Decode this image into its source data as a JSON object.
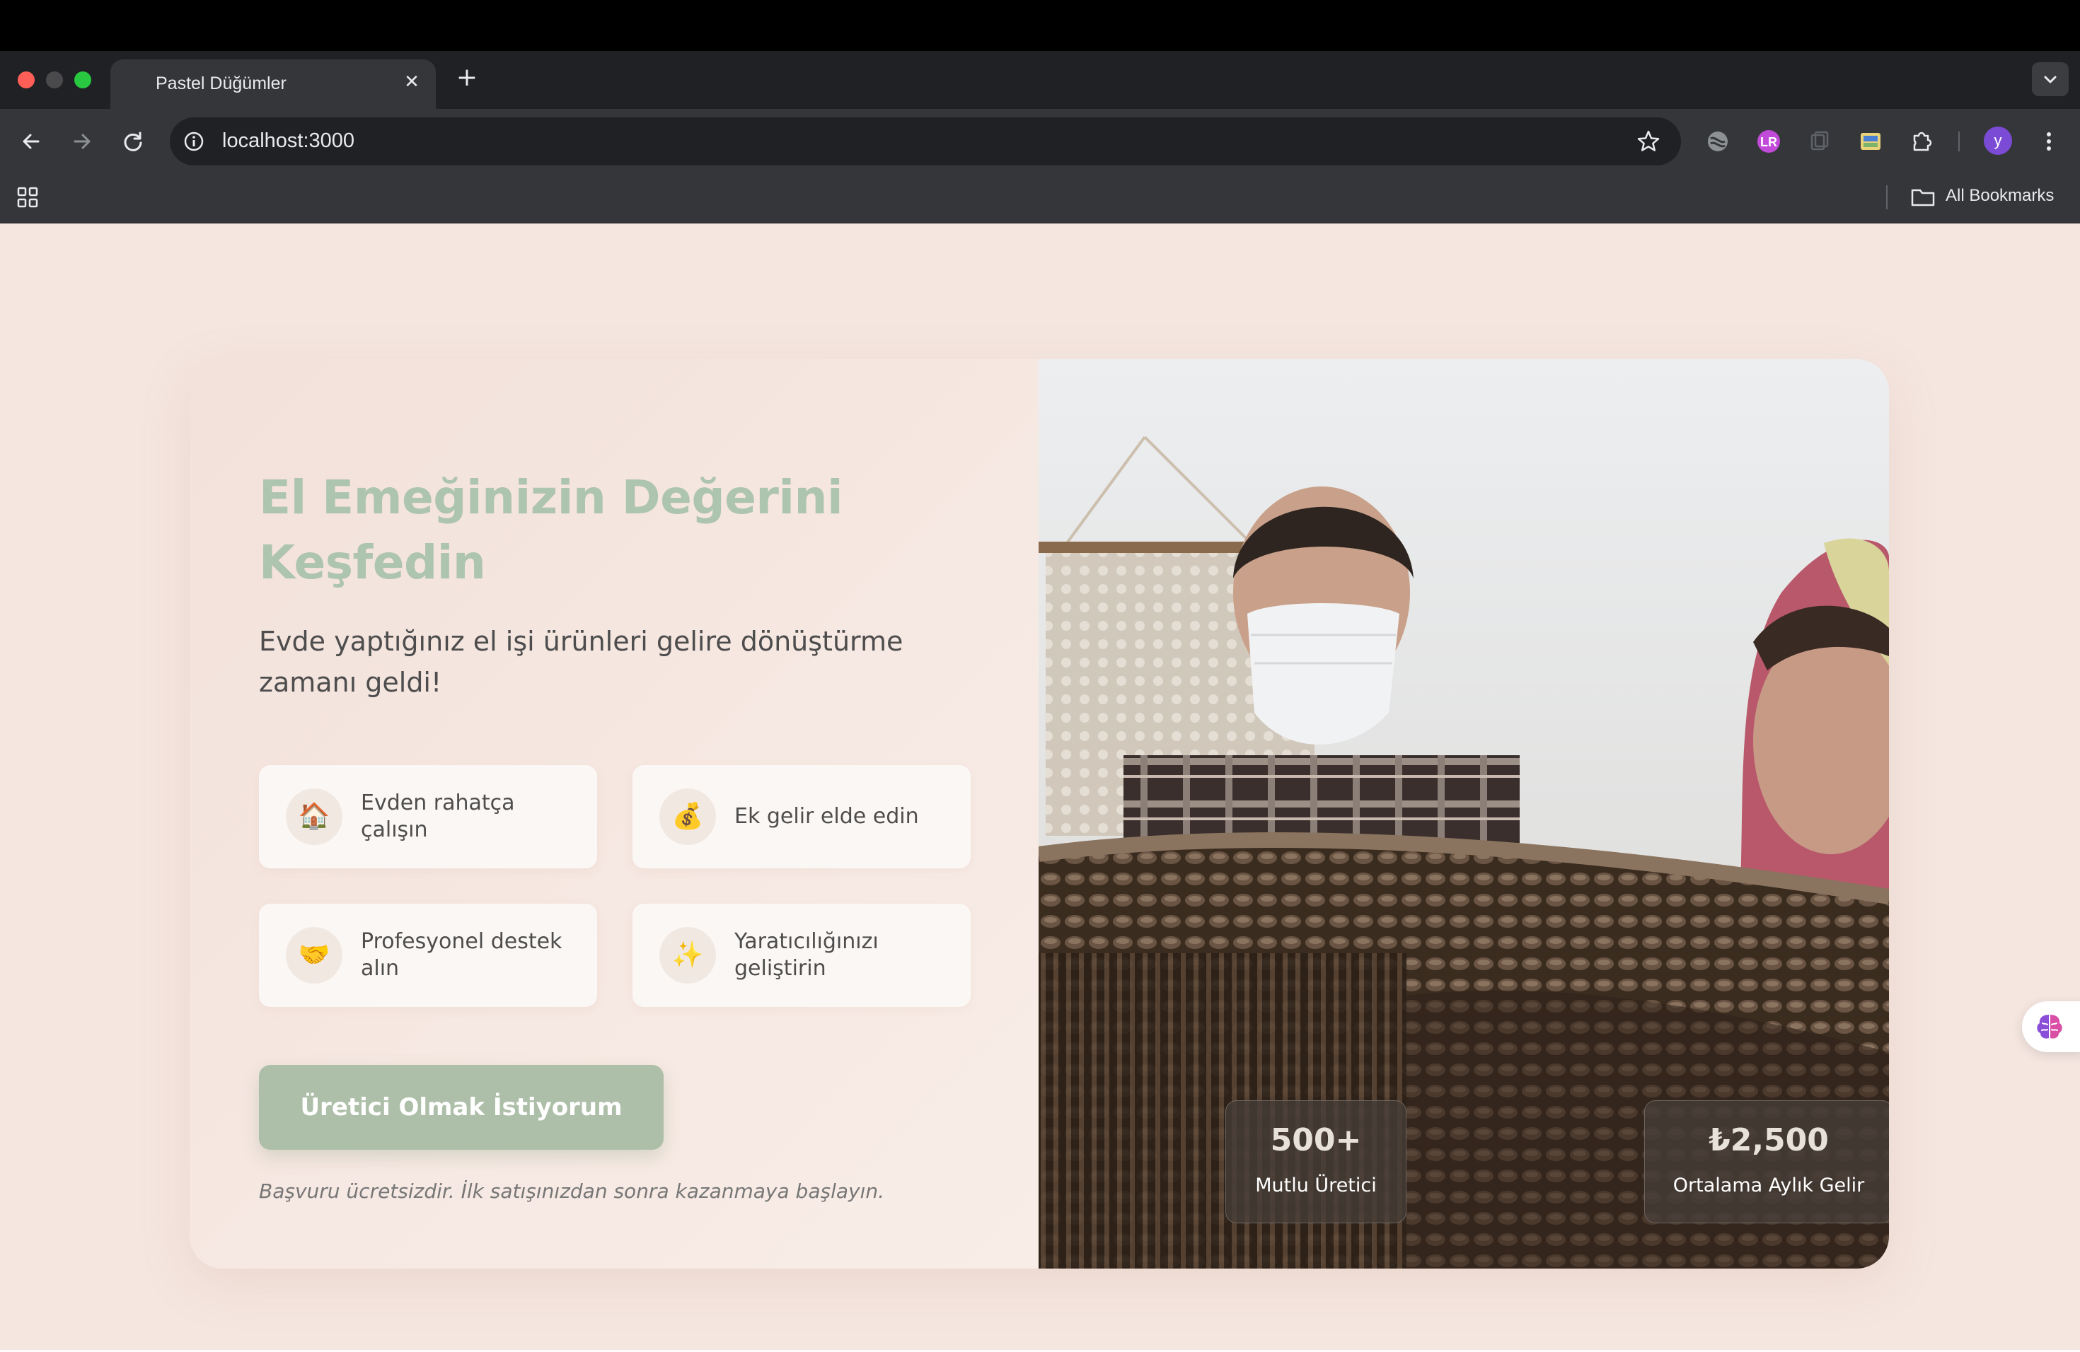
{
  "browser": {
    "tab_title": "Pastel Düğümler",
    "url": "localhost:3000",
    "profile_initial": "y",
    "bookmarks_label": "All Bookmarks"
  },
  "hero": {
    "title_line1": "El Emeğinizin Değerini",
    "title_line2": "Keşfedin",
    "subtitle": "Evde yaptığınız el işi ürünleri gelire dönüştürme zamanı geldi!",
    "features": [
      {
        "icon": "🏠",
        "icon_name": "house-icon",
        "text": "Evden rahatça çalışın"
      },
      {
        "icon": "💰",
        "icon_name": "money-bag-icon",
        "text": "Ek gelir elde edin"
      },
      {
        "icon": "🤝",
        "icon_name": "handshake-icon",
        "text": "Profesyonel destek alın"
      },
      {
        "icon": "✨",
        "icon_name": "sparkles-icon",
        "text": "Yaratıcılığınızı geliştirin"
      }
    ],
    "cta_label": "Üretici Olmak İstiyorum",
    "note": "Başvuru ücretsizdir. İlk satışınızdan sonra kazanmaya başlayın.",
    "stats": [
      {
        "value": "500+",
        "label": "Mutlu Üretici"
      },
      {
        "value": "₺2,500",
        "label": "Ortalama Aylık Gelir"
      }
    ]
  },
  "colors": {
    "page_background": "#f5e6e0",
    "title": "#adc4ae",
    "cta": "#aebfa9"
  }
}
